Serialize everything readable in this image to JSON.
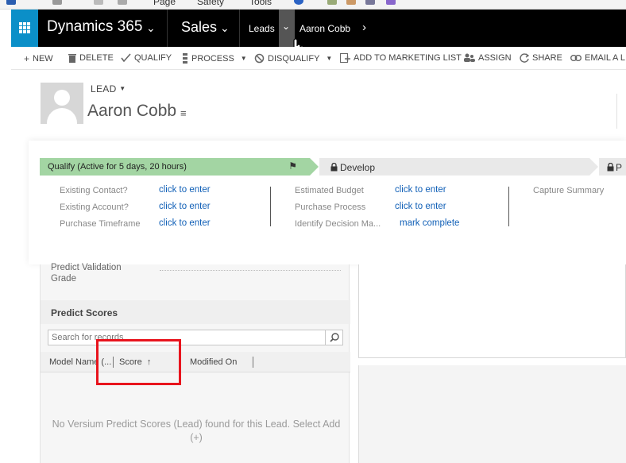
{
  "browser": {
    "menu_items": [
      "Page",
      "Safety",
      "Tools"
    ]
  },
  "nav": {
    "app_name": "Dynamics 365",
    "area": "Sales",
    "entity": "Leads",
    "record": "Aaron Cobb",
    "waffle_color": "#0b8fc8"
  },
  "commands": {
    "new": "NEW",
    "delete": "DELETE",
    "qualify": "QUALIFY",
    "process": "PROCESS",
    "disqualify": "DISQUALIFY",
    "add_to_marketing_list": "ADD TO MARKETING LIST",
    "assign": "ASSIGN",
    "share": "SHARE",
    "email_link": "EMAIL A LI"
  },
  "header": {
    "entity_label": "LEAD",
    "record_title": "Aaron Cobb"
  },
  "process": {
    "active_stage": "Qualify (Active for 5 days, 20 hours)",
    "next_stage": "Develop",
    "third_stage": "P",
    "active_color": "#a3d5a3",
    "fields": [
      {
        "label": "Existing Contact?",
        "value": "click to enter"
      },
      {
        "label": "Existing Account?",
        "value": "click to enter"
      },
      {
        "label": "Purchase Timeframe",
        "value": "click to enter"
      },
      {
        "label": "Estimated Budget",
        "value": "click to enter"
      },
      {
        "label": "Purchase Process",
        "value": "click to enter"
      },
      {
        "label": "Identify Decision Ma...",
        "value": "mark complete"
      },
      {
        "label": "Capture Summary",
        "value": ""
      }
    ]
  },
  "form": {
    "predict_validation_label": "Predict Validation Grade"
  },
  "subgrid": {
    "title": "Predict Scores",
    "search_placeholder": "Search for records",
    "columns": [
      "Model Name (...",
      "Score",
      "Modified On"
    ],
    "sort_indicator": "↑",
    "empty_message": "No Versium Predict Scores (Lead) found for this Lead. Select Add (+)"
  },
  "highlight_color": "#e8141d"
}
